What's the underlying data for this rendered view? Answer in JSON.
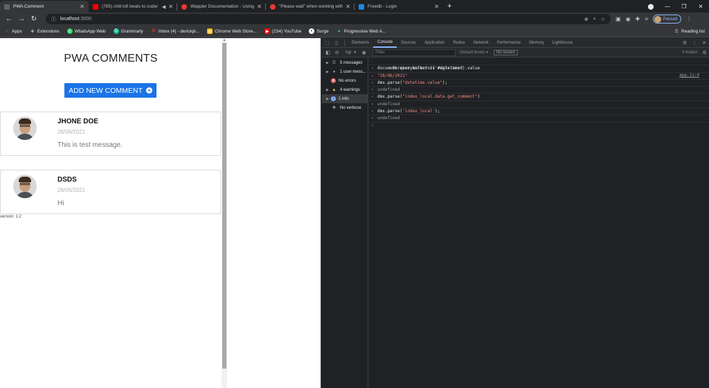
{
  "browser": {
    "tabs": [
      {
        "title": "PWA Comment",
        "color": "#3c4043"
      },
      {
        "title": "(785) chill lofi beats to code/",
        "color": "#ff0000"
      },
      {
        "title": "Wappler Documentation - Using",
        "color": "#e53935"
      },
      {
        "title": "\"Please wait\" when working with",
        "color": "#e53935"
      },
      {
        "title": "Freedb - Login",
        "color": "#1e88e5"
      }
    ],
    "new_tab": "+",
    "url_host": "localhost",
    "url_port": ":3000",
    "profile_label": "Paused",
    "bookmarks": [
      {
        "label": "Apps",
        "color": "#8ab4f8"
      },
      {
        "label": "Extensions",
        "color": "#9aa0a6"
      },
      {
        "label": "WhatsApp Web",
        "color": "#25d366"
      },
      {
        "label": "Grammarly",
        "color": "#15c39a"
      },
      {
        "label": "Inbox (4) - derickpi...",
        "color": "#ea4335"
      },
      {
        "label": "Chrome Web Store...",
        "color": "#fbbc04"
      },
      {
        "label": "(234) YouTube",
        "color": "#ff0000"
      },
      {
        "label": "Surge",
        "color": "#ffffff"
      },
      {
        "label": "Progressive Web A...",
        "color": "#4caf50"
      }
    ],
    "reading_list": "Reading list"
  },
  "app": {
    "title": "PWA COMMENTS",
    "add_button": "ADD NEW COMMENT",
    "comments": [
      {
        "name": "JHONE DOE",
        "date": "28/06/2021",
        "message": "This is test message."
      },
      {
        "name": "DSDS",
        "date": "28/06/2021",
        "message": "Hi"
      }
    ],
    "version": "version: 1.2"
  },
  "devtools": {
    "tabs": [
      "Elements",
      "Console",
      "Sources",
      "Application",
      "Redux",
      "Network",
      "Performance",
      "Memory",
      "Lighthouse"
    ],
    "active_tab": "Console",
    "context": "top",
    "filter_placeholder": "Filter",
    "levels": "Default levels",
    "issues": "No Issues",
    "hidden": "4 hidden",
    "sidebar": [
      {
        "label": "5 messages",
        "icon": "list",
        "color": "#9aa0a6"
      },
      {
        "label": "1 user mess...",
        "icon": "user",
        "color": "#9aa0a6"
      },
      {
        "label": "No errors",
        "icon": "error",
        "color": "#f28b82"
      },
      {
        "label": "4 warnings",
        "icon": "warning",
        "color": "#fdd663"
      },
      {
        "label": "1 info",
        "icon": "info",
        "color": "#8ab4f8"
      },
      {
        "label": "No verbose",
        "icon": "verbose",
        "color": "#9aa0a6"
      }
    ],
    "console": {
      "service_worker": "Service worker is registered",
      "service_worker_src": "app.js:4",
      "cmd1": "document.querySelector('#datetime').value",
      "res1": "\"28/06/2021\"",
      "cmd2_pre": "dmx.parse(",
      "cmd2_arg": "\"datetime.value\"",
      "cmd2_post": ");",
      "res2": "undefined",
      "cmd3_pre": "dmx.parse(",
      "cmd3_arg": "\"index_local.data.get_comment\"",
      "cmd3_post": ")",
      "res3": "undefined",
      "cmd4_pre": "dmx.parse(",
      "cmd4_arg": "'index_local'",
      "cmd4_post": ");",
      "res4": "undefined"
    }
  }
}
